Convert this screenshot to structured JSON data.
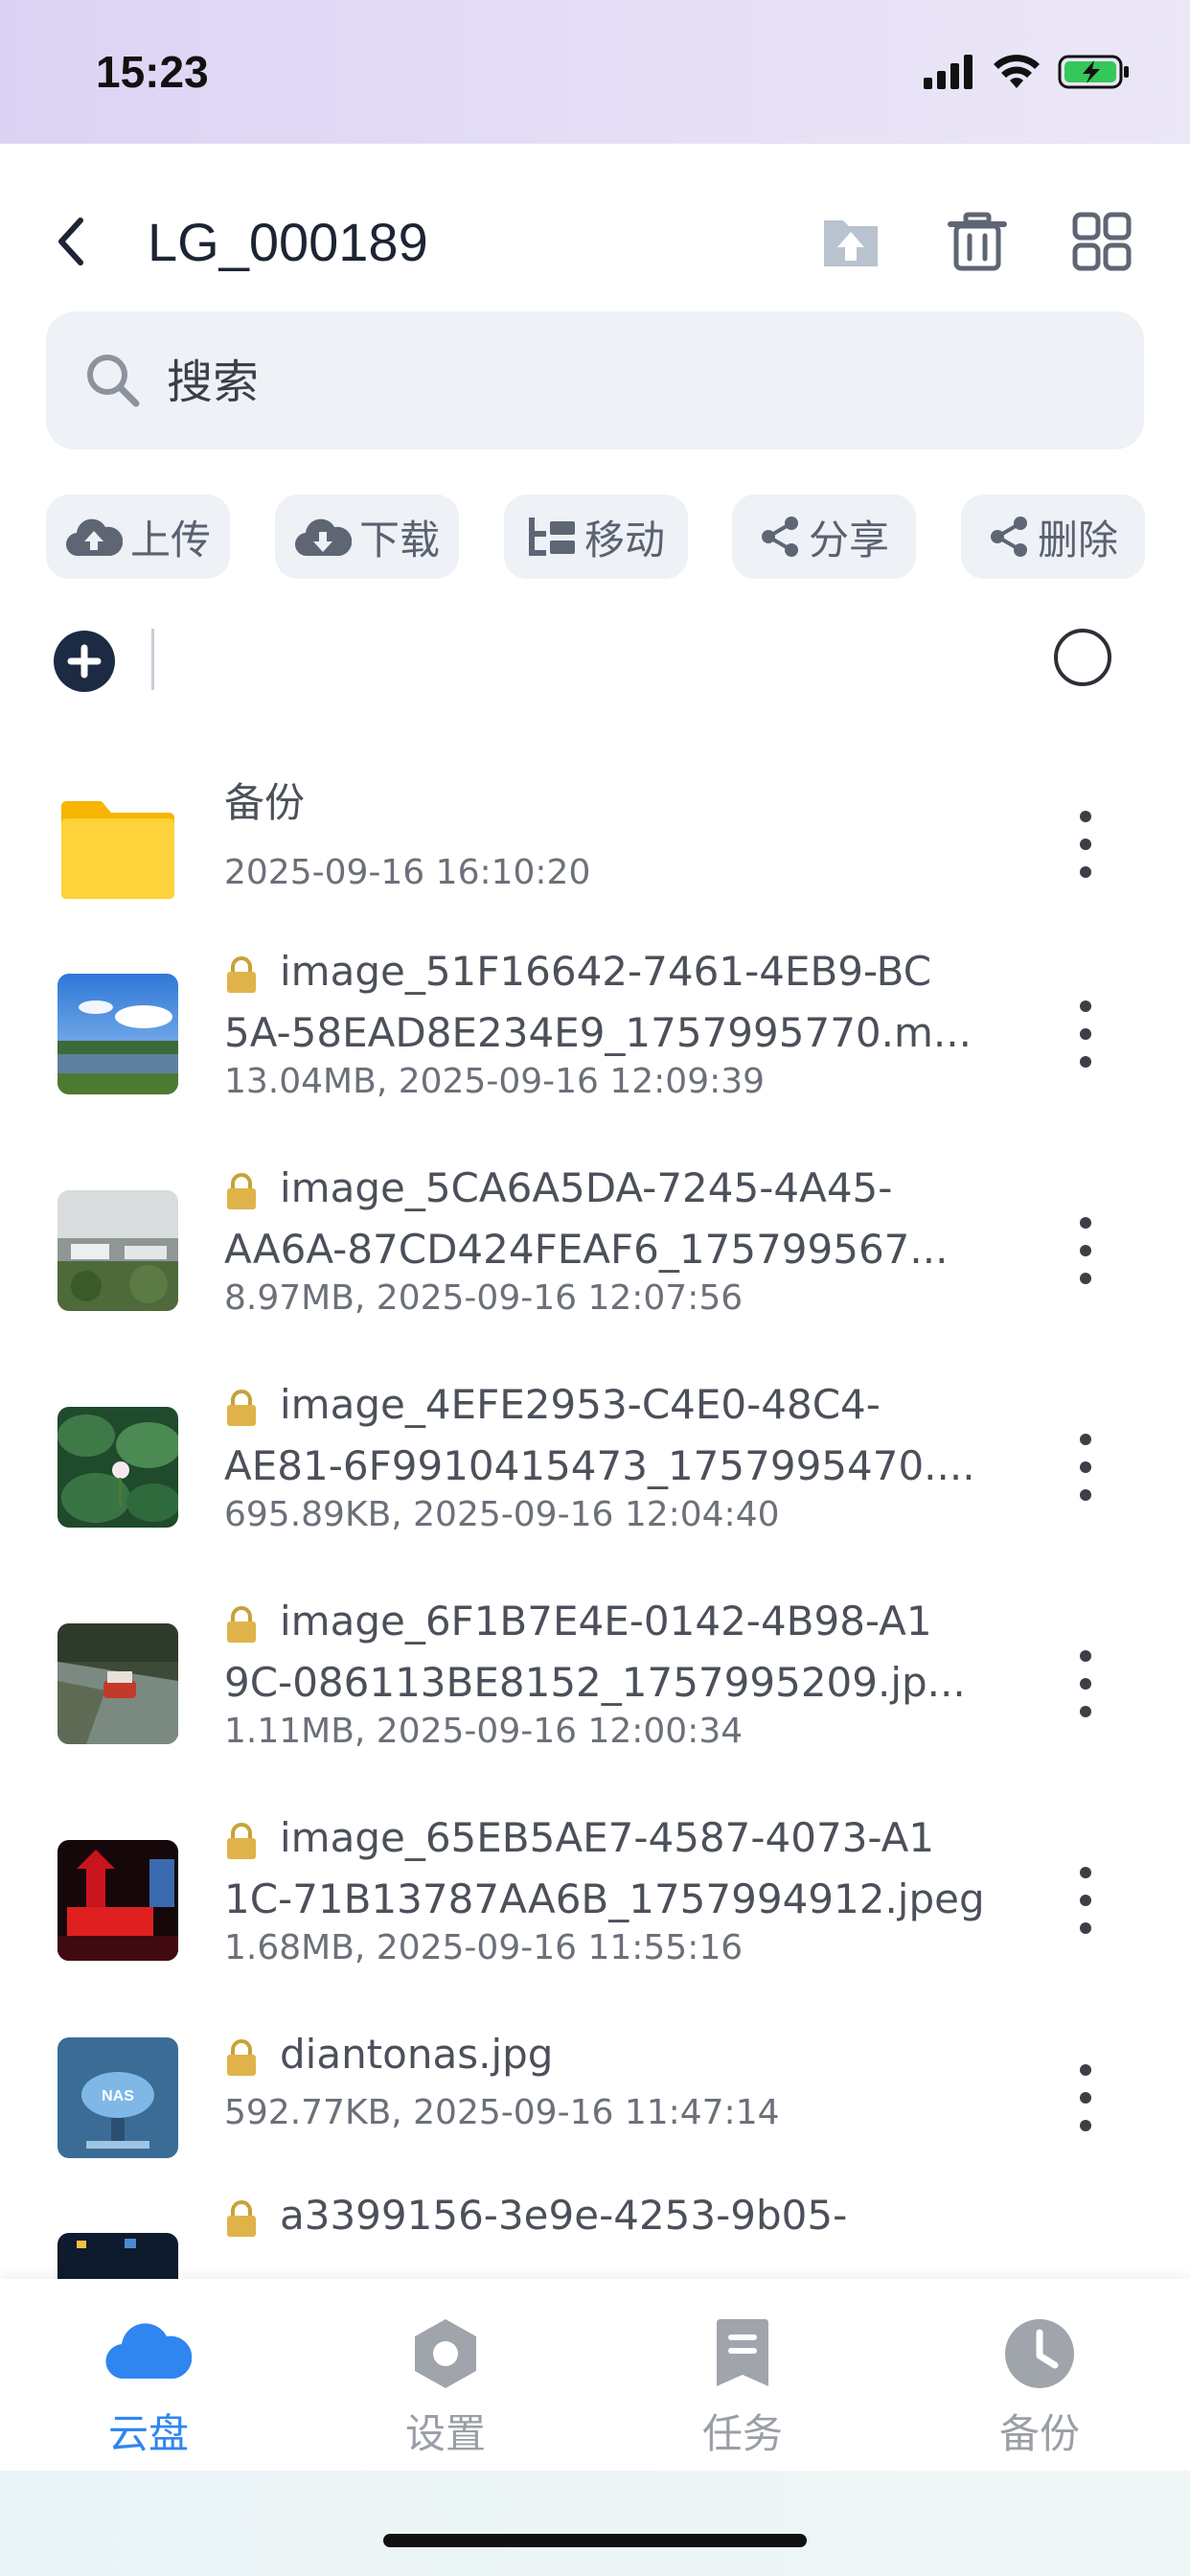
{
  "status": {
    "time": "15:23"
  },
  "header": {
    "title": "LG_000189"
  },
  "search": {
    "placeholder": "搜索"
  },
  "actions": [
    {
      "label": "上传",
      "icon": "cloud-upload-icon"
    },
    {
      "label": "下载",
      "icon": "cloud-download-icon"
    },
    {
      "label": "移动",
      "icon": "move-icon"
    },
    {
      "label": "分享",
      "icon": "share-icon"
    },
    {
      "label": "删除",
      "icon": "share-icon"
    }
  ],
  "files": [
    {
      "name_lines": [
        "备份"
      ],
      "meta": "2025-09-16 16:10:20",
      "type": "folder",
      "locked": false
    },
    {
      "name_lines": [
        "image_51F16642-7461-4EB9-BC",
        "5A-58EAD8E234E9_1757995770.m..."
      ],
      "meta": "13.04MB, 2025-09-16 12:09:39",
      "type": "image",
      "locked": true
    },
    {
      "name_lines": [
        "image_5CA6A5DA-7245-4A45-",
        "AA6A-87CD424FEAF6_175799567..."
      ],
      "meta": "8.97MB, 2025-09-16 12:07:56",
      "type": "image",
      "locked": true
    },
    {
      "name_lines": [
        "image_4EFE2953-C4E0-48C4-",
        "AE81-6F9910415473_1757995470...."
      ],
      "meta": "695.89KB, 2025-09-16 12:04:40",
      "type": "image",
      "locked": true
    },
    {
      "name_lines": [
        "image_6F1B7E4E-0142-4B98-A1",
        "9C-086113BE8152_1757995209.jp..."
      ],
      "meta": "1.11MB, 2025-09-16 12:00:34",
      "type": "image",
      "locked": true
    },
    {
      "name_lines": [
        "image_65EB5AE7-4587-4073-A1",
        "1C-71B13787AA6B_1757994912.jpeg"
      ],
      "meta": "1.68MB, 2025-09-16 11:55:16",
      "type": "image",
      "locked": true
    },
    {
      "name_lines": [
        "diantonas.jpg"
      ],
      "meta": "592.77KB, 2025-09-16 11:47:14",
      "type": "image",
      "locked": true
    },
    {
      "name_lines": [
        "a3399156-3e9e-4253-9b05-"
      ],
      "meta": "",
      "type": "image",
      "locked": true
    }
  ],
  "thumb_text": {
    "nas": "NAS"
  },
  "nav": [
    {
      "label": "云盘",
      "icon": "cloud-icon",
      "active": true
    },
    {
      "label": "设置",
      "icon": "settings-icon",
      "active": false
    },
    {
      "label": "任务",
      "icon": "task-icon",
      "active": false
    },
    {
      "label": "备份",
      "icon": "clock-icon",
      "active": false
    }
  ],
  "colors": {
    "accent": "#2f86f0",
    "folder": "#fdd23b",
    "dark": "#1c2a43"
  }
}
